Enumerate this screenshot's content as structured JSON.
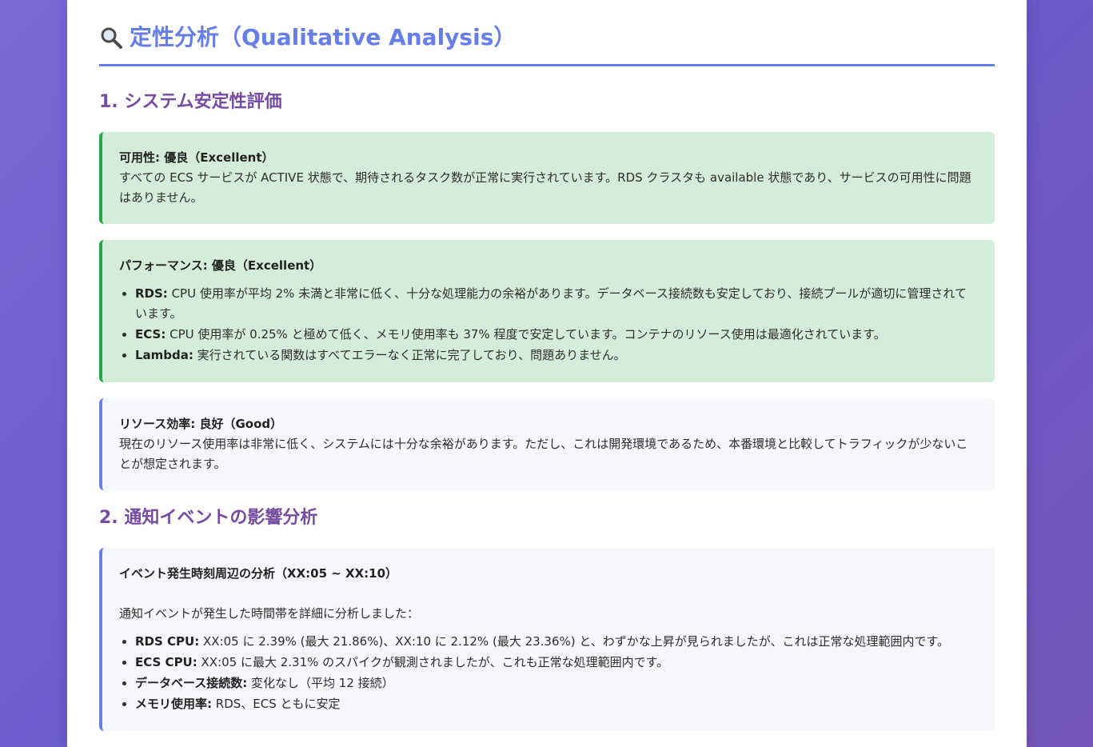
{
  "heading": {
    "icon": "magnifier-icon",
    "title": "定性分析（Qualitative Analysis）"
  },
  "section1": {
    "title": "1. システム安定性評価",
    "availability": {
      "title": "可用性: 優良（Excellent）",
      "text": "すべての ECS サービスが ACTIVE 状態で、期待されるタスク数が正常に実行されています。RDS クラスタも available 状態であり、サービスの可用性に問題はありません。"
    },
    "performance": {
      "title": "パフォーマンス: 優良（Excellent）",
      "items": [
        {
          "label": "RDS:",
          "text": " CPU 使用率が平均 2% 未満と非常に低く、十分な処理能力の余裕があります。データベース接続数も安定しており、接続プールが適切に管理されています。"
        },
        {
          "label": "ECS:",
          "text": " CPU 使用率が 0.25% と極めて低く、メモリ使用率も 37% 程度で安定しています。コンテナのリソース使用は最適化されています。"
        },
        {
          "label": "Lambda:",
          "text": " 実行されている関数はすべてエラーなく正常に完了しており、問題ありません。"
        }
      ]
    },
    "efficiency": {
      "title": "リソース効率: 良好（Good）",
      "text": "現在のリソース使用率は非常に低く、システムには十分な余裕があります。ただし、これは開発環境であるため、本番環境と比較してトラフィックが少ないことが想定されます。"
    }
  },
  "section2": {
    "title": "2. 通知イベントの影響分析",
    "event": {
      "title": "イベント発生時刻周辺の分析（XX:05 ~ XX:10）",
      "intro": "通知イベントが発生した時間帯を詳細に分析しました：",
      "items": [
        {
          "label": "RDS CPU:",
          "text": " XX:05 に 2.39% (最大 21.86%)、XX:10 に 2.12% (最大 23.36%) と、わずかな上昇が見られましたが、これは正常な処理範囲内です。"
        },
        {
          "label": "ECS CPU:",
          "text": " XX:05 に最大 2.31% のスパイクが観測されましたが、これも正常な処理範囲内です。"
        },
        {
          "label": "データベース接続数:",
          "text": " 変化なし（平均 12 接続）"
        },
        {
          "label": "メモリ使用率:",
          "text": " RDS、ECS ともに安定"
        }
      ]
    }
  }
}
